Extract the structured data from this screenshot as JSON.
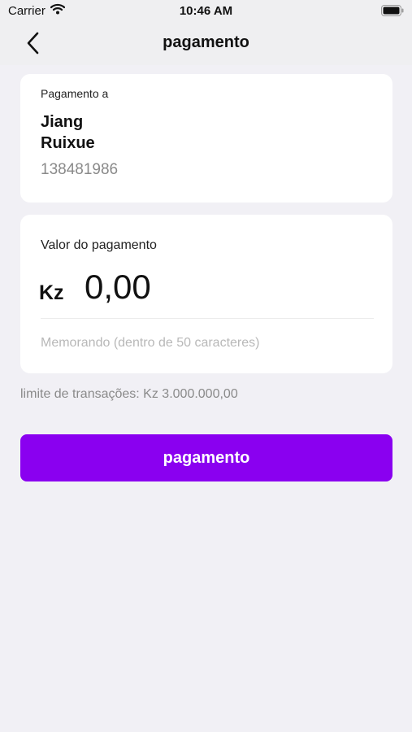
{
  "status_bar": {
    "carrier": "Carrier",
    "time": "10:46 AM",
    "wifi_icon": "wifi-icon",
    "battery_icon": "battery-icon"
  },
  "nav": {
    "back_icon": "chevron-left-icon",
    "title": "pagamento"
  },
  "payee": {
    "label": "Pagamento a",
    "name": "Jiang Ruixue",
    "number": "138481986"
  },
  "amount": {
    "label": "Valor do pagamento",
    "currency": "Kz",
    "value": "0,00",
    "memo_placeholder": "Memorando (dentro de 50 caracteres)",
    "memo_value": ""
  },
  "limit_text": "limite de transações: Kz 3.000.000,00",
  "pay_button_label": "pagamento",
  "colors": {
    "accent": "#8a00f0",
    "background": "#f1f0f5"
  }
}
